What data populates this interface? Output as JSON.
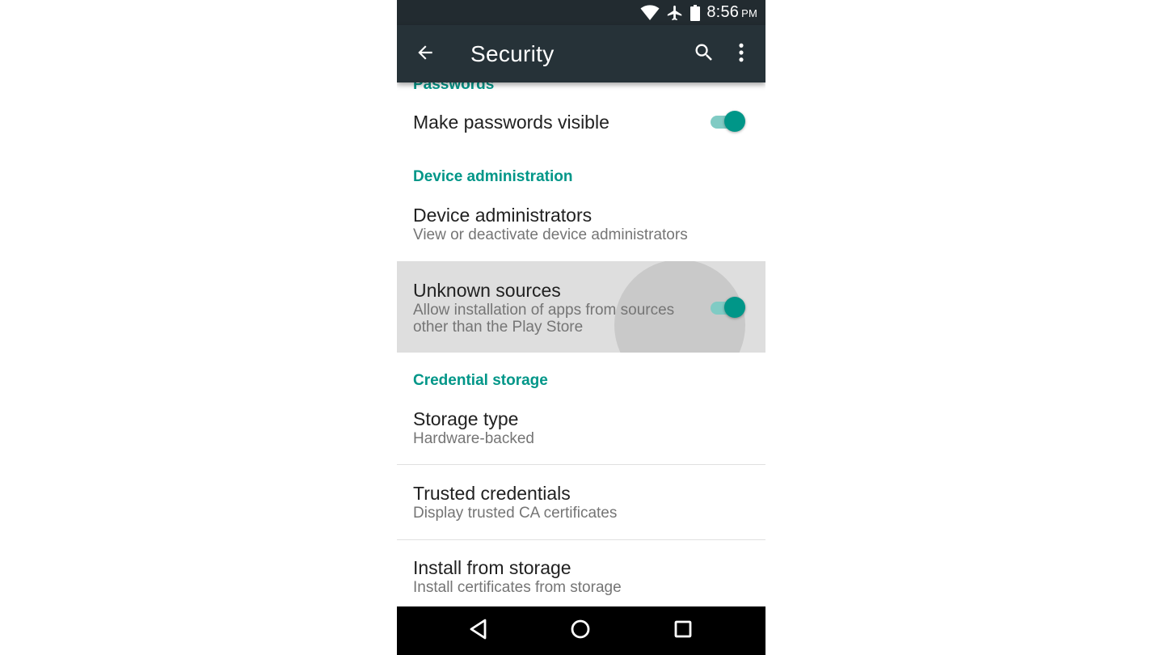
{
  "status_bar": {
    "time": "8:56",
    "ampm": "PM",
    "icons": [
      "wifi-icon",
      "airplane-icon",
      "battery-icon"
    ]
  },
  "toolbar": {
    "title": "Security",
    "icons": [
      "back-arrow-icon",
      "search-icon",
      "more-vert-icon"
    ]
  },
  "sections": {
    "passwords": {
      "header": "Passwords",
      "make_passwords_visible": {
        "title": "Make passwords visible",
        "toggle_on": true
      }
    },
    "device_administration": {
      "header": "Device administration",
      "device_administrators": {
        "title": "Device administrators",
        "subtitle": "View or deactivate device administrators"
      },
      "unknown_sources": {
        "title": "Unknown sources",
        "subtitle_line1": "Allow installation of apps from sources",
        "subtitle_line2": "other than the Play Store",
        "toggle_on": true
      }
    },
    "credential_storage": {
      "header": "Credential storage",
      "storage_type": {
        "title": "Storage type",
        "subtitle": "Hardware-backed"
      },
      "trusted_credentials": {
        "title": "Trusted credentials",
        "subtitle": "Display trusted CA certificates"
      },
      "install_from_storage": {
        "title": "Install from storage",
        "subtitle": "Install certificates from storage"
      }
    }
  },
  "nav_bar": {
    "icons": [
      "nav-back-icon",
      "nav-home-icon",
      "nav-recents-icon"
    ]
  },
  "colors": {
    "accent": "#009688",
    "toolbar": "#263238",
    "status_bar": "#222b30"
  }
}
